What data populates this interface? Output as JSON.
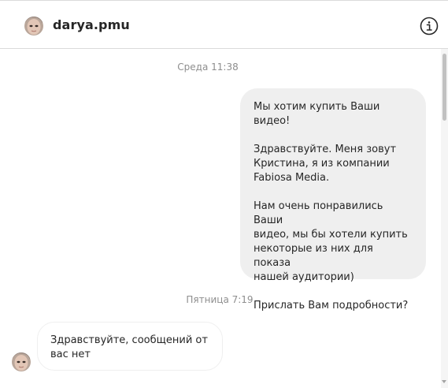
{
  "header": {
    "username": "darya.pmu",
    "avatar_icon": "user-avatar",
    "info_icon": "info-icon"
  },
  "conversation": {
    "timestamps": [
      "Среда 11:38",
      "Пятница 7:19"
    ],
    "outgoing_message": {
      "lines": [
        "Мы хотим купить Ваши видео!",
        "",
        "Здравствуйте. Меня зовут",
        "Кристина, я из компании",
        "Fabiosa Media.",
        "",
        "Нам очень понравились Ваши",
        "видео, мы бы хотели купить",
        "некоторые из них для показа",
        "нашей аудитории)",
        "",
        "Прислать Вам подробности?"
      ]
    },
    "incoming_message": {
      "lines": [
        "Здравствуйте, сообщений от",
        "вас нет"
      ]
    }
  },
  "colors": {
    "outgoing_bubble": "#efefef",
    "incoming_border": "#efefef",
    "timestamp": "#8e8e8e",
    "text": "#262626",
    "divider": "#dbdbdb"
  }
}
